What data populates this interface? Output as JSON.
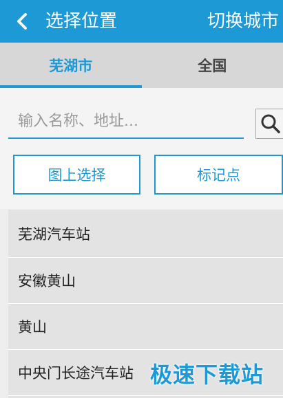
{
  "header": {
    "title": "选择位置",
    "switch_city": "切换城市",
    "back_icon": "chevron-left-icon"
  },
  "tabs": [
    {
      "label": "芜湖市",
      "active": true
    },
    {
      "label": "全国",
      "active": false
    }
  ],
  "search": {
    "placeholder": "输入名称、地址...",
    "value": "",
    "icon": "search-icon"
  },
  "actions": {
    "select_on_map": "图上选择",
    "mark_point": "标记点"
  },
  "results": [
    "芜湖汽车站",
    "安徽黄山",
    "黄山",
    "中央门长途汽车站"
  ],
  "watermark": "极速下载站",
  "colors": {
    "accent": "#1d9ad6",
    "tab_bar": "#d7d7d7",
    "list_bg": "#e3e3e3"
  }
}
